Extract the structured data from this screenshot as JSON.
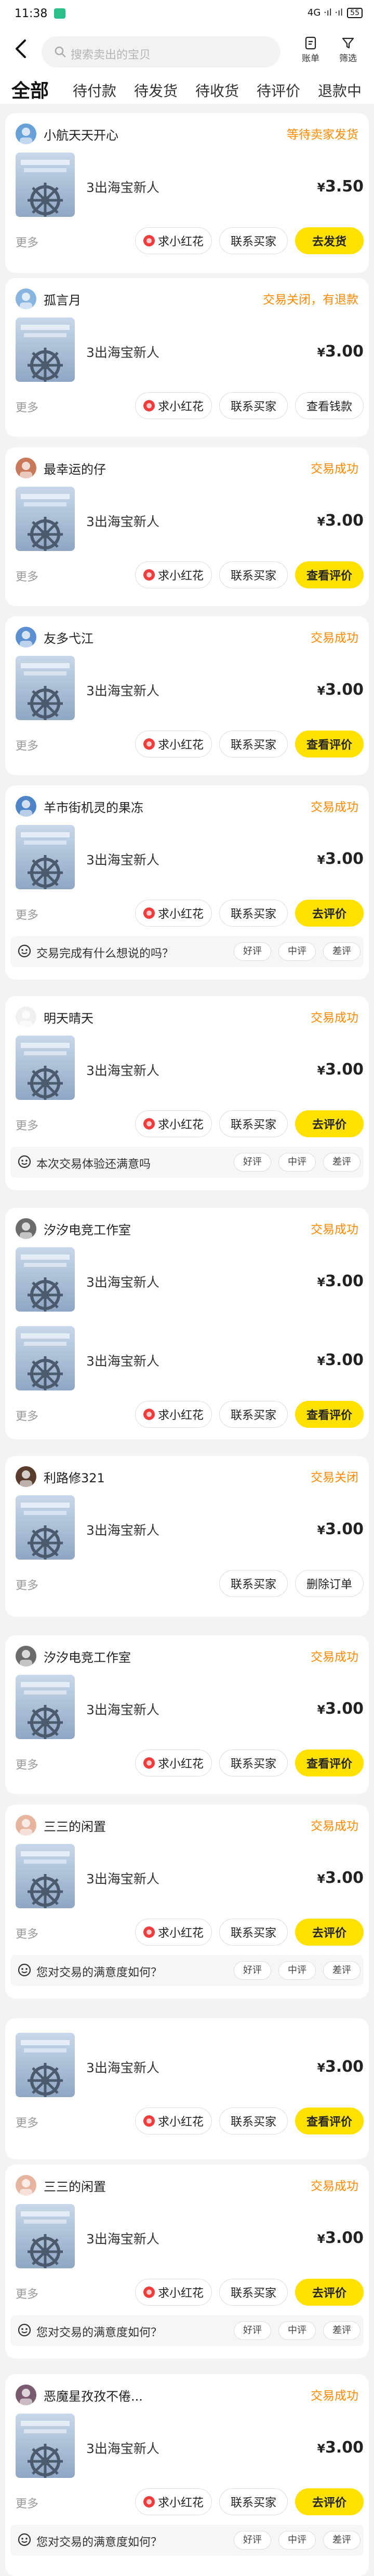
{
  "status_bar": {
    "time": "11:38",
    "signal": "4G ·ıl ·ıl",
    "battery": "55"
  },
  "header": {
    "search_placeholder": "搜索卖出的宝贝",
    "ledger_label": "账单",
    "filter_label": "筛选"
  },
  "tabs": [
    "全部",
    "待付款",
    "待发货",
    "待收货",
    "待评价",
    "退款中"
  ],
  "labels": {
    "more": "更多",
    "ask_flower": "求小红花",
    "contact_buyer": "联系买家",
    "ship": "去发货",
    "view_refund": "查看钱款",
    "view_review": "查看评价",
    "go_review": "去评价",
    "delete_order": "删除订单",
    "good": "好评",
    "mid": "中评",
    "bad": "差评"
  },
  "orders": [
    {
      "buyer": "小航天天开心",
      "status": "等待卖家发货",
      "items": [
        {
          "title": "3出海宝新人",
          "price": "3.50"
        }
      ]
    },
    {
      "buyer": "孤言月",
      "status": "交易关闭，有退款",
      "items": [
        {
          "title": "3出海宝新人",
          "price": "3.00"
        }
      ]
    },
    {
      "buyer": "最幸运的仔",
      "status": "交易成功",
      "items": [
        {
          "title": "3出海宝新人",
          "price": "3.00"
        }
      ]
    },
    {
      "buyer": "友多弋江",
      "status": "交易成功",
      "items": [
        {
          "title": "3出海宝新人",
          "price": "3.00"
        }
      ]
    },
    {
      "buyer": "羊市街机灵的果冻",
      "status": "交易成功",
      "items": [
        {
          "title": "3出海宝新人",
          "price": "3.00"
        }
      ],
      "question": "交易完成有什么想说的吗？"
    },
    {
      "buyer": "明天晴天",
      "status": "交易成功",
      "items": [
        {
          "title": "3出海宝新人",
          "price": "3.00"
        }
      ],
      "question": "本次交易体验还满意吗"
    },
    {
      "buyer": "汐汐电竞工作室",
      "status": "交易成功",
      "items": [
        {
          "title": "3出海宝新人",
          "price": "3.00"
        },
        {
          "title": "3出海宝新人",
          "price": "3.00"
        }
      ]
    },
    {
      "buyer": "利路修321",
      "status": "交易关闭",
      "items": [
        {
          "title": "3出海宝新人",
          "price": "3.00"
        }
      ]
    },
    {
      "buyer": "汐汐电竞工作室",
      "status": "交易成功",
      "items": [
        {
          "title": "3出海宝新人",
          "price": "3.00"
        }
      ]
    },
    {
      "buyer": "三三的闲置",
      "status": "交易成功",
      "items": [
        {
          "title": "3出海宝新人",
          "price": "3.00"
        }
      ],
      "question": "您对交易的满意度如何？"
    },
    {
      "buyer": "",
      "status": "",
      "items": [
        {
          "title": "3出海宝新人",
          "price": "3.00"
        }
      ]
    },
    {
      "buyer": "三三的闲置",
      "status": "交易成功",
      "items": [
        {
          "title": "3出海宝新人",
          "price": "3.00"
        }
      ],
      "question": "您对交易的满意度如何？"
    },
    {
      "buyer": "恶魔星孜孜不倦...",
      "status": "交易成功",
      "items": [
        {
          "title": "3出海宝新人",
          "price": "3.00"
        }
      ],
      "question": "您对交易的满意度如何？"
    }
  ]
}
